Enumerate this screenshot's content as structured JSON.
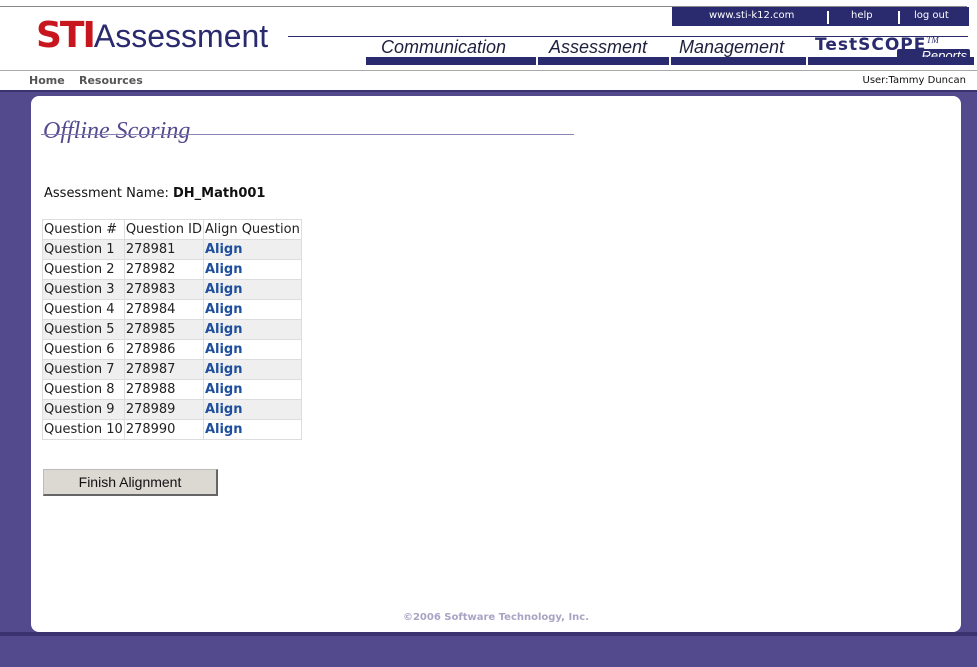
{
  "header": {
    "logo": {
      "sti": "STI",
      "assessment": "Assessment"
    },
    "utility_links": [
      {
        "label": "www.sti-k12.com"
      },
      {
        "label": "help"
      },
      {
        "label": "log out"
      }
    ],
    "nav": {
      "communication": "Communication",
      "assessment": "Assessment",
      "management": "Management",
      "testscope": "TestSCOPE",
      "tm": "TM",
      "reports": "Reports"
    }
  },
  "subnav": {
    "home": "Home",
    "resources": "Resources",
    "user": "User:Tammy Duncan"
  },
  "main": {
    "title": "Offline Scoring",
    "assessment_label": "Assessment Name: ",
    "assessment_name": "DH_Math001",
    "table": {
      "headers": [
        "Question #",
        "Question ID",
        "Align Question"
      ],
      "rows": [
        {
          "question": "Question 1",
          "id": "278981",
          "action": "Align"
        },
        {
          "question": "Question 2",
          "id": "278982",
          "action": "Align"
        },
        {
          "question": "Question 3",
          "id": "278983",
          "action": "Align"
        },
        {
          "question": "Question 4",
          "id": "278984",
          "action": "Align"
        },
        {
          "question": "Question 5",
          "id": "278985",
          "action": "Align"
        },
        {
          "question": "Question 6",
          "id": "278986",
          "action": "Align"
        },
        {
          "question": "Question 7",
          "id": "278987",
          "action": "Align"
        },
        {
          "question": "Question 8",
          "id": "278988",
          "action": "Align"
        },
        {
          "question": "Question 9",
          "id": "278989",
          "action": "Align"
        },
        {
          "question": "Question 10",
          "id": "278990",
          "action": "Align"
        }
      ]
    },
    "finish_button": "Finish Alignment"
  },
  "footer": {
    "copyright": "©2006 Software Technology, Inc."
  },
  "colors": {
    "background": "#534a8e",
    "nav_dark": "#2a2a6e",
    "logo_red": "#c8161e",
    "link_blue": "#1f4f9c"
  }
}
